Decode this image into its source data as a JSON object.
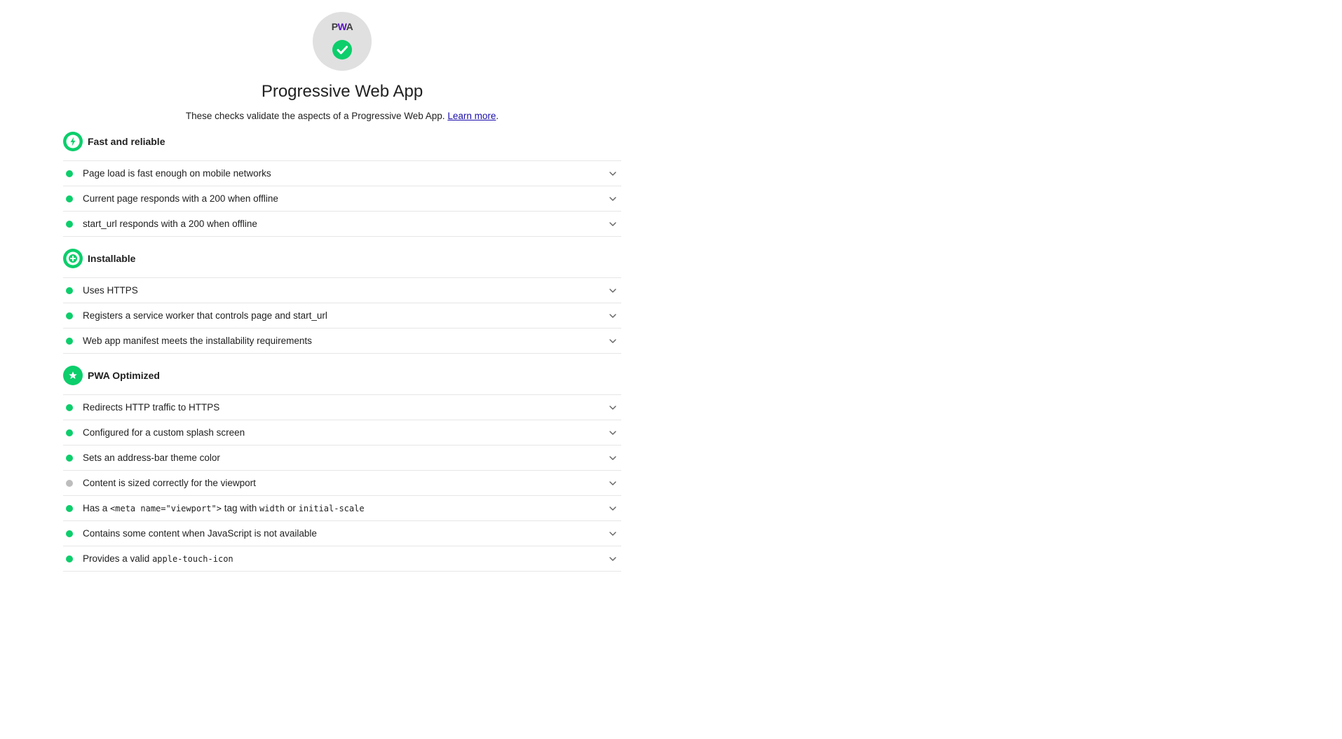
{
  "header": {
    "logo_text_p": "P",
    "logo_text_w": "W",
    "logo_text_a": "A",
    "title": "Progressive Web App",
    "subtitle_text": "These checks validate the aspects of a Progressive Web App.",
    "learn_more": "Learn more",
    "subtitle_end": "."
  },
  "colors": {
    "pass": "#0cce6b",
    "na": "#bdbdbd",
    "gauge_bg": "#e0e0e0",
    "link": "#1a0dab"
  },
  "groups": [
    {
      "title": "Fast and reliable",
      "icon": "lightning-icon",
      "audits": [
        {
          "status": "pass",
          "parts": [
            {
              "t": "Page load is fast enough on mobile networks"
            }
          ]
        },
        {
          "status": "pass",
          "parts": [
            {
              "t": "Current page responds with a 200 when offline"
            }
          ]
        },
        {
          "status": "pass",
          "parts": [
            {
              "t": "start_url responds with a 200 when offline"
            }
          ]
        }
      ]
    },
    {
      "title": "Installable",
      "icon": "plus-icon",
      "audits": [
        {
          "status": "pass",
          "parts": [
            {
              "t": "Uses HTTPS"
            }
          ]
        },
        {
          "status": "pass",
          "parts": [
            {
              "t": "Registers a service worker that controls page and start_url"
            }
          ]
        },
        {
          "status": "pass",
          "parts": [
            {
              "t": "Web app manifest meets the installability requirements"
            }
          ]
        }
      ]
    },
    {
      "title": "PWA Optimized",
      "icon": "star-icon",
      "audits": [
        {
          "status": "pass",
          "parts": [
            {
              "t": "Redirects HTTP traffic to HTTPS"
            }
          ]
        },
        {
          "status": "pass",
          "parts": [
            {
              "t": "Configured for a custom splash screen"
            }
          ]
        },
        {
          "status": "pass",
          "parts": [
            {
              "t": "Sets an address-bar theme color"
            }
          ]
        },
        {
          "status": "na",
          "parts": [
            {
              "t": "Content is sized correctly for the viewport"
            }
          ]
        },
        {
          "status": "pass",
          "parts": [
            {
              "t": "Has a "
            },
            {
              "c": "<meta name=\"viewport\">"
            },
            {
              "t": " tag with "
            },
            {
              "c": "width"
            },
            {
              "t": " or "
            },
            {
              "c": "initial-scale"
            }
          ]
        },
        {
          "status": "pass",
          "parts": [
            {
              "t": "Contains some content when JavaScript is not available"
            }
          ]
        },
        {
          "status": "pass",
          "parts": [
            {
              "t": "Provides a valid "
            },
            {
              "c": "apple-touch-icon"
            }
          ]
        }
      ]
    }
  ]
}
